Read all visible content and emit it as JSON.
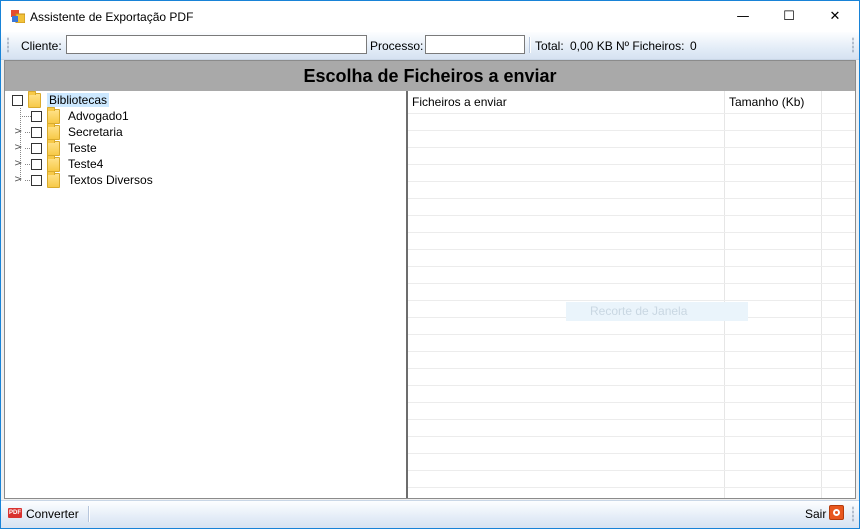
{
  "window": {
    "title": "Assistente de Exportação PDF",
    "minimize_glyph": "—",
    "maximize_glyph": "☐",
    "close_glyph": "✕"
  },
  "toolbar": {
    "cliente_label": "Cliente:",
    "cliente_value": "",
    "processo_label": "Processo:",
    "processo_value": "",
    "total_label": "Total:",
    "total_value": "0,00 KB",
    "count_label": "Nº Ficheiros:",
    "count_value": "0"
  },
  "header": {
    "title": "Escolha de Ficheiros a enviar"
  },
  "tree": {
    "root": {
      "label": "Bibliotecas",
      "checked": false,
      "icon": "folder-icon"
    },
    "children": [
      {
        "label": "Advogado1",
        "expandable": false,
        "checked": false
      },
      {
        "label": "Secretaria",
        "expandable": true,
        "checked": false
      },
      {
        "label": "Teste",
        "expandable": true,
        "checked": false
      },
      {
        "label": "Teste4",
        "expandable": true,
        "checked": false
      },
      {
        "label": "Textos Diversos",
        "expandable": true,
        "checked": false
      }
    ]
  },
  "files_grid": {
    "columns": [
      "Ficheiros a enviar",
      "Tamanho (Kb)"
    ],
    "rows": [],
    "overlay_text": "Recorte de Janela"
  },
  "statusbar": {
    "convert_label": "Converter",
    "exit_label": "Sair"
  },
  "colors": {
    "title_border": "#1883d7",
    "header_bar": "#a9a9a9",
    "selection": "#cce8ff"
  }
}
